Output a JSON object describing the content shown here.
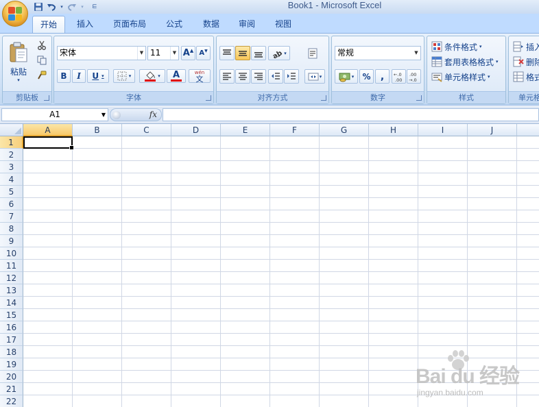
{
  "window": {
    "title": "Book1 - Microsoft Excel"
  },
  "quick_access": {
    "items": [
      "save-icon",
      "undo-icon",
      "redo-icon",
      "customize-icon"
    ]
  },
  "tabs": [
    {
      "label": "开始",
      "active": true
    },
    {
      "label": "插入"
    },
    {
      "label": "页面布局"
    },
    {
      "label": "公式"
    },
    {
      "label": "数据"
    },
    {
      "label": "审阅"
    },
    {
      "label": "视图"
    }
  ],
  "ribbon": {
    "clipboard": {
      "label": "剪贴板",
      "paste_label": "粘贴"
    },
    "font": {
      "label": "字体",
      "font_name": "宋体",
      "font_size": "11",
      "bold": "B",
      "italic": "I",
      "underline": "U",
      "phonetic": "wén",
      "phonetic_char": "文",
      "font_color_glyph": "A",
      "grow_glyph": "A",
      "shrink_glyph": "A"
    },
    "alignment": {
      "label": "对齐方式"
    },
    "number": {
      "label": "数字",
      "format": "常规",
      "percent": "%",
      "comma": ",",
      "inc_decimal": "+.0\n.00",
      "dec_decimal": ".00\n→.0"
    },
    "styles": {
      "label": "样式",
      "conditional": "条件格式",
      "table": "套用表格格式",
      "cell_styles": "单元格样式"
    },
    "cells": {
      "label": "单元格",
      "insert": "插入",
      "delete": "删除",
      "format": "格式"
    }
  },
  "formula_bar": {
    "name_box": "A1",
    "fx": "fx",
    "value": ""
  },
  "sheet": {
    "columns": [
      "A",
      "B",
      "C",
      "D",
      "E",
      "F",
      "G",
      "H",
      "I",
      "J"
    ],
    "rows": [
      "1",
      "2",
      "3",
      "4",
      "5",
      "6",
      "7",
      "8",
      "9",
      "10",
      "11",
      "12",
      "13",
      "14",
      "15",
      "16",
      "17",
      "18",
      "19",
      "20",
      "21",
      "22"
    ],
    "active_cell": "A1",
    "selected_column": "A",
    "selected_row": "1"
  },
  "watermark": {
    "brand": "Bai du 经验",
    "url": "jingyan.baidu.com"
  },
  "colors": {
    "accent": "#15428b",
    "selection_header": "#f8c96b",
    "gridline": "#d0d7e5",
    "ribbon": "#cfe1f6"
  }
}
